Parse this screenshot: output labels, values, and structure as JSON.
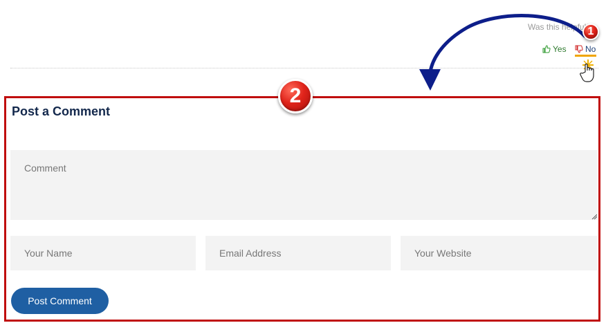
{
  "helpful": {
    "question": "Was this helpful?",
    "yes_label": "Yes",
    "no_label": "No",
    "yes_icon": "thumbs-up-icon",
    "no_icon": "thumbs-down-icon"
  },
  "annotations": {
    "step1": "1",
    "step2": "2",
    "badge_color": "#e0241b",
    "arrow_color": "#0d1e8a"
  },
  "comment_form": {
    "title": "Post a Comment",
    "comment_placeholder": "Comment",
    "name_placeholder": "Your Name",
    "email_placeholder": "Email Address",
    "website_placeholder": "Your Website",
    "submit_label": "Post Comment",
    "highlight_color": "#c00d0d",
    "button_color": "#1f5fa3"
  }
}
